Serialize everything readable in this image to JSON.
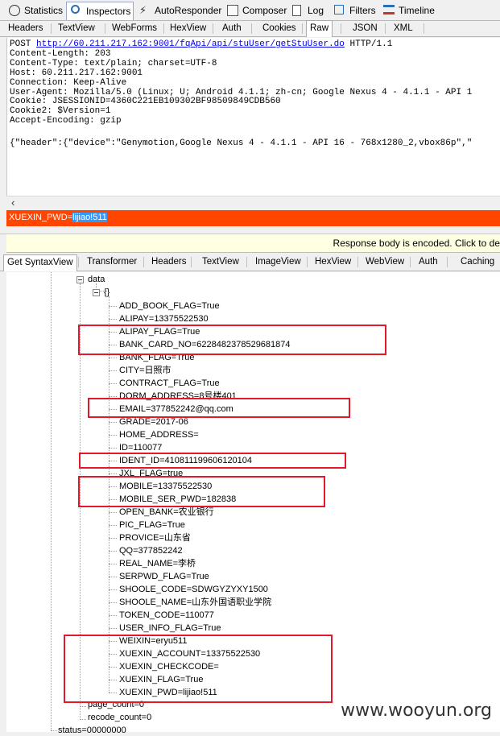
{
  "top_tabs": [
    {
      "label": "Statistics",
      "icon": "stopwatch-icon"
    },
    {
      "label": "Inspectors",
      "icon": "magnifier-icon"
    },
    {
      "label": "AutoResponder",
      "icon": "lightning-icon"
    },
    {
      "label": "Composer",
      "icon": "pencil-icon"
    },
    {
      "label": "Log",
      "icon": "log-icon"
    },
    {
      "label": "Filters",
      "icon": "checkbox-icon"
    },
    {
      "label": "Timeline",
      "icon": "timeline-icon"
    }
  ],
  "request_tabs": [
    "Headers",
    "TextView",
    "WebForms",
    "HexView",
    "Auth",
    "Cookies",
    "Raw",
    "JSON",
    "XML"
  ],
  "raw": {
    "method": "POST ",
    "url": "http://60.211.217.162:9001/fqApi/api/stuUser/getStuUser.do",
    "protocol": " HTTP/1.1",
    "lines": [
      "Content-Length: 203",
      "Content-Type: text/plain; charset=UTF-8",
      "Host: 60.211.217.162:9001",
      "Connection: Keep-Alive",
      "User-Agent: Mozilla/5.0 (Linux; U; Android 4.1.1; zh-cn; Google Nexus 4 - 4.1.1 - API 1",
      "Cookie: JSESSIONID=4360C221EB109302BF98509849CDB560",
      "Cookie2: $Version=1",
      "Accept-Encoding: gzip",
      "",
      "{\"header\":{\"device\":\"Genymotion,Google Nexus 4 - 4.1.1 - API 16 - 768x1280_2,vbox86p\",\""
    ]
  },
  "find": {
    "prefix": "XUEXIN_PWD=",
    "match": "lijiao!511"
  },
  "notice": "Response body is encoded. Click to de",
  "response_tabs": [
    "Get SyntaxView",
    "Transformer",
    "Headers",
    "TextView",
    "ImageView",
    "HexView",
    "WebView",
    "Auth",
    "Caching"
  ],
  "tree": {
    "data_label": "data",
    "obj_label": "{}",
    "items": [
      "ADD_BOOK_FLAG=True",
      "ALIPAY=13375522530",
      "ALIPAY_FLAG=True",
      "BANK_CARD_NO=6228482378529681874",
      "BANK_FLAG=True",
      "CITY=日照市",
      "CONTRACT_FLAG=True",
      "DORM_ADDRESS=8号楼401",
      "EMAIL=377852242@qq.com",
      "GRADE=2017-06",
      "HOME_ADDRESS=",
      "ID=110077",
      "IDENT_ID=410811199606120104",
      "JXL_FLAG=true",
      "MOBILE=13375522530",
      "MOBILE_SER_PWD=182838",
      "OPEN_BANK=农业银行",
      "PIC_FLAG=True",
      "PROVICE=山东省",
      "QQ=377852242",
      "REAL_NAME=李桥",
      "SERPWD_FLAG=True",
      "SHOOLE_CODE=SDWGYZYXY1500",
      "SHOOLE_NAME=山东外国语职业学院",
      "TOKEN_CODE=110077",
      "USER_INFO_FLAG=True",
      "WEIXIN=eryu511",
      "XUEXIN_ACCOUNT=13375522530",
      "XUEXIN_CHECKCODE=",
      "XUEXIN_FLAG=True",
      "XUEXIN_PWD=lijiao!511"
    ],
    "page_count": "page_count=0",
    "recode_count": "recode_count=0",
    "status": "status=00000000"
  },
  "highlight_color": "#e0192b",
  "find_bar_color": "#ff4500",
  "watermark": "www.wooyun.org"
}
